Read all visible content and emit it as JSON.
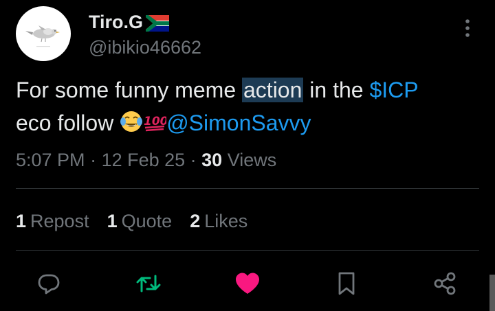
{
  "author": {
    "display_name": "Tiro.G",
    "flag_icon": "south-africa-flag-icon",
    "handle": "@ibikio46662",
    "avatar_icon": "bird-avatar"
  },
  "tweet": {
    "text_parts": {
      "p1": "For some funny meme ",
      "p2": "action",
      "p3": " in the ",
      "p4": "$ICP",
      "p5": "eco follow ",
      "p6": "@SimonSavvy"
    },
    "emojis": [
      "joy-emoji",
      "hundred-points-emoji"
    ],
    "highlight_color": "#1d3b54",
    "link_color": "#1d9bf0"
  },
  "meta": {
    "time": "5:07 PM",
    "sep1": " · ",
    "date": "12 Feb 25",
    "sep2": " · ",
    "views_count": "30",
    "views_label": "Views"
  },
  "stats": {
    "reposts_count": "1",
    "reposts_label": "Repost",
    "quotes_count": "1",
    "quotes_label": "Quote",
    "likes_count": "2",
    "likes_label": "Likes"
  },
  "actions": {
    "reply_icon": "reply-icon",
    "repost_icon": "repost-icon",
    "like_icon": "heart-icon",
    "bookmark_icon": "bookmark-icon",
    "share_icon": "share-icon",
    "repost_color": "#00ba7c",
    "like_color": "#f91880"
  }
}
